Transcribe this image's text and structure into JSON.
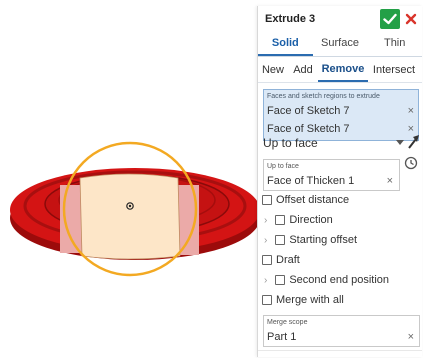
{
  "dialog": {
    "title": "Extrude 3",
    "ok_icon": "check-icon",
    "cancel_icon": "close-icon",
    "tabs": [
      {
        "label": "Solid",
        "active": true
      },
      {
        "label": "Surface",
        "active": false
      },
      {
        "label": "Thin",
        "active": false
      }
    ],
    "operations": [
      {
        "label": "New",
        "active": false
      },
      {
        "label": "Add",
        "active": false
      },
      {
        "label": "Remove",
        "active": true
      },
      {
        "label": "Intersect",
        "active": false
      }
    ],
    "query": {
      "label": "Faces and sketch regions to extrude",
      "items": [
        "Face of Sketch 7",
        "Face of Sketch 7"
      ]
    },
    "end_type": "Up to face",
    "up_to_face": {
      "label": "Up to face",
      "value": "Face of Thicken 1"
    },
    "options": {
      "offset_distance": "Offset distance",
      "direction": "Direction",
      "starting_offset": "Starting offset",
      "draft": "Draft",
      "second_end_position": "Second end position",
      "merge_with_all": "Merge with all"
    },
    "merge_scope": {
      "label": "Merge scope",
      "value": "Part 1"
    }
  },
  "colors": {
    "accent": "#2b6cb0",
    "ok_green": "#23a047",
    "cancel_red": "#d9342b",
    "selection_blue": "#dbe8f6",
    "part_red": "#d41414",
    "region_cream": "#fde6c8",
    "highlight_orange": "#f3a922"
  }
}
